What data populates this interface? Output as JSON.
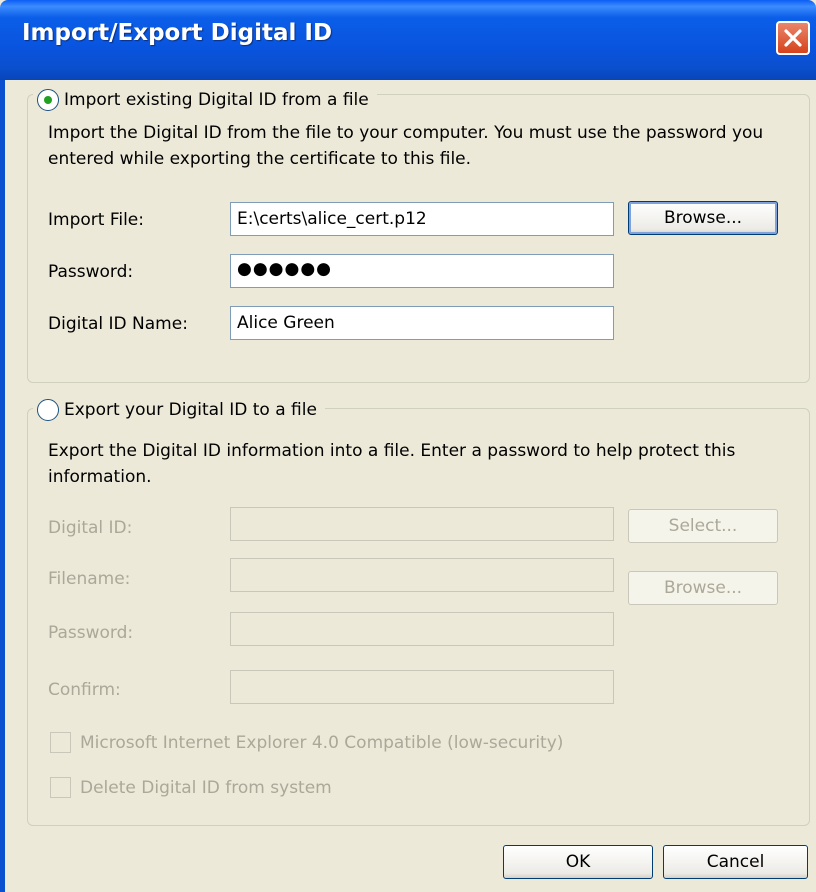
{
  "window": {
    "title": "Import/Export Digital ID"
  },
  "import_section": {
    "radio_label": "Import existing Digital ID from a file",
    "selected": true,
    "description": "Import the Digital ID from the file to your computer. You must use the password you entered while exporting the certificate to this file.",
    "import_file_label": "Import File:",
    "import_file_value": "E:\\certs\\alice_cert.p12",
    "browse_label": "Browse...",
    "password_label": "Password:",
    "password_value": "●●●●●●",
    "name_label": "Digital ID Name:",
    "name_value": "Alice Green"
  },
  "export_section": {
    "radio_label": "Export your Digital ID to a file",
    "selected": false,
    "description": "Export the Digital ID information into a file. Enter a password to help protect this information.",
    "digital_id_label": "Digital ID:",
    "select_label": "Select...",
    "filename_label": "Filename:",
    "browse_label": "Browse...",
    "password_label": "Password:",
    "confirm_label": "Confirm:",
    "ie_compat_label": "Microsoft Internet Explorer 4.0 Compatible (low-security)",
    "delete_label": "Delete Digital ID from system"
  },
  "footer": {
    "ok_label": "OK",
    "cancel_label": "Cancel"
  },
  "icons": {
    "close": "close-icon",
    "radio": "radio-button"
  }
}
